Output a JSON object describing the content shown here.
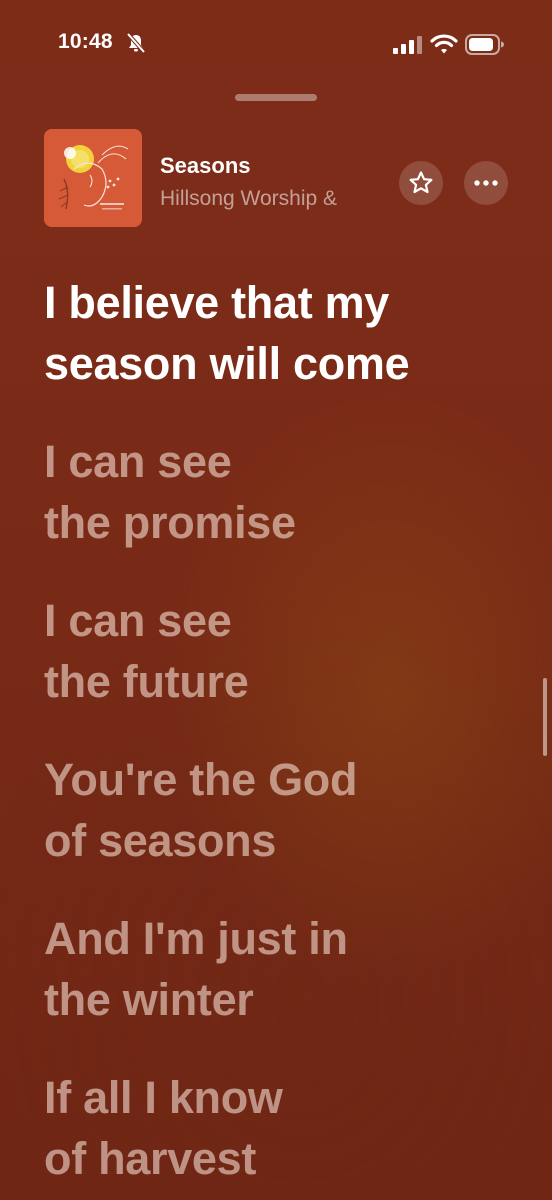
{
  "status_bar": {
    "time": "10:48",
    "icons": [
      "bell-slash-icon",
      "cellular-signal-icon",
      "wifi-icon",
      "battery-icon"
    ]
  },
  "now_playing": {
    "title": "Seasons",
    "artist": "Hillsong Worship &",
    "artwork_icon": "album-artwork",
    "star_icon": "star-icon",
    "more_icon": "ellipsis-icon"
  },
  "lyrics": [
    {
      "lines": [
        "I believe that my",
        "season will come"
      ],
      "active": true
    },
    {
      "lines": [
        "I can see",
        "the promise"
      ],
      "active": false
    },
    {
      "lines": [
        "I can see",
        "the future"
      ],
      "active": false
    },
    {
      "lines": [
        "You're the God",
        "of seasons"
      ],
      "active": false
    },
    {
      "lines": [
        "And I'm just in",
        "the winter"
      ],
      "active": false
    },
    {
      "lines": [
        "If all I know",
        "of harvest"
      ],
      "active": false
    }
  ],
  "colors": {
    "background": "#7a2b17",
    "active_lyric": "#ffffff",
    "inactive_lyric": "#e8a98f",
    "artwork": "#d75a38"
  }
}
